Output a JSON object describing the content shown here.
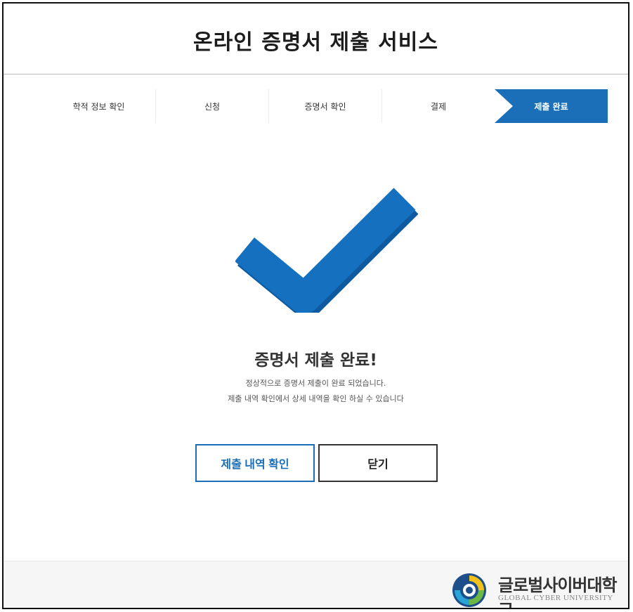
{
  "header": {
    "title": "온라인 증명서 제출 서비스"
  },
  "steps": [
    {
      "label": "학적 정보 확인"
    },
    {
      "label": "신청"
    },
    {
      "label": "증명서 확인"
    },
    {
      "label": "결제"
    },
    {
      "label": "제출 완료",
      "active": true
    }
  ],
  "result": {
    "icon": "check-icon",
    "title": "증명서 제출 완료!",
    "line1": "정상적으로 증명서 제출이 완료 되었습니다.",
    "line2": "제출 내역 확인에서 상세 내역을 확인 하실 수 있습니다"
  },
  "buttons": {
    "history_label": "제출 내역 확인",
    "close_label": "닫기"
  },
  "footer": {
    "logo_icon": "university-logo-icon",
    "name_ko": "글로벌사이버대학교",
    "name_en": "GLOBAL CYBER UNIVERSITY"
  },
  "colors": {
    "accent": "#1a6fb8",
    "check": "#1570c0",
    "check_shadow": "#0d5aa0"
  }
}
